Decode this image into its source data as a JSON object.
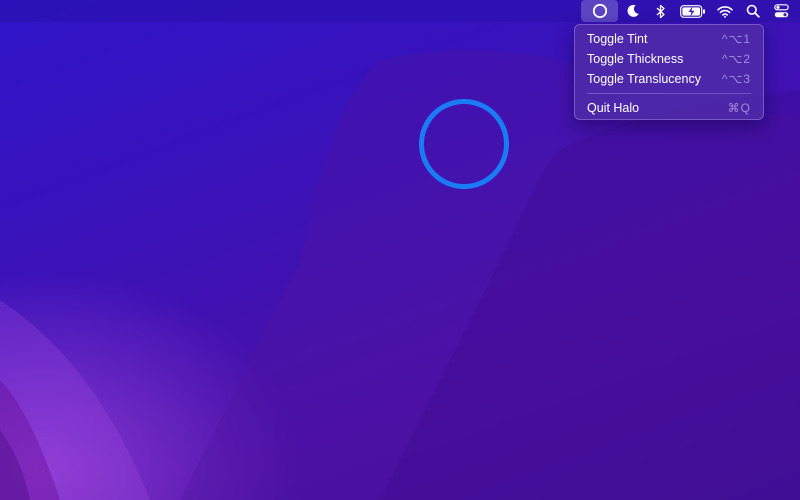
{
  "menubar": {
    "status_items": [
      {
        "icon": "halo-circle-icon",
        "active": true
      },
      {
        "icon": "moon-icon"
      },
      {
        "icon": "bluetooth-icon"
      },
      {
        "icon": "battery-charging-icon"
      },
      {
        "icon": "wifi-icon"
      },
      {
        "icon": "search-icon"
      },
      {
        "icon": "control-center-icon"
      }
    ]
  },
  "menu": {
    "items": [
      {
        "label": "Toggle Tint",
        "shortcut": "^⌥1"
      },
      {
        "label": "Toggle Thickness",
        "shortcut": "^⌥2"
      },
      {
        "label": "Toggle Translucency",
        "shortcut": "^⌥3"
      }
    ],
    "quit": {
      "label": "Quit Halo",
      "shortcut": "⌘Q"
    }
  },
  "colors": {
    "halo_ring": "#1a7cf5",
    "wallpaper_top": "#2f14c9",
    "wallpaper_bottom": "#3c0e96",
    "menu_background": "#4e2aa8"
  }
}
